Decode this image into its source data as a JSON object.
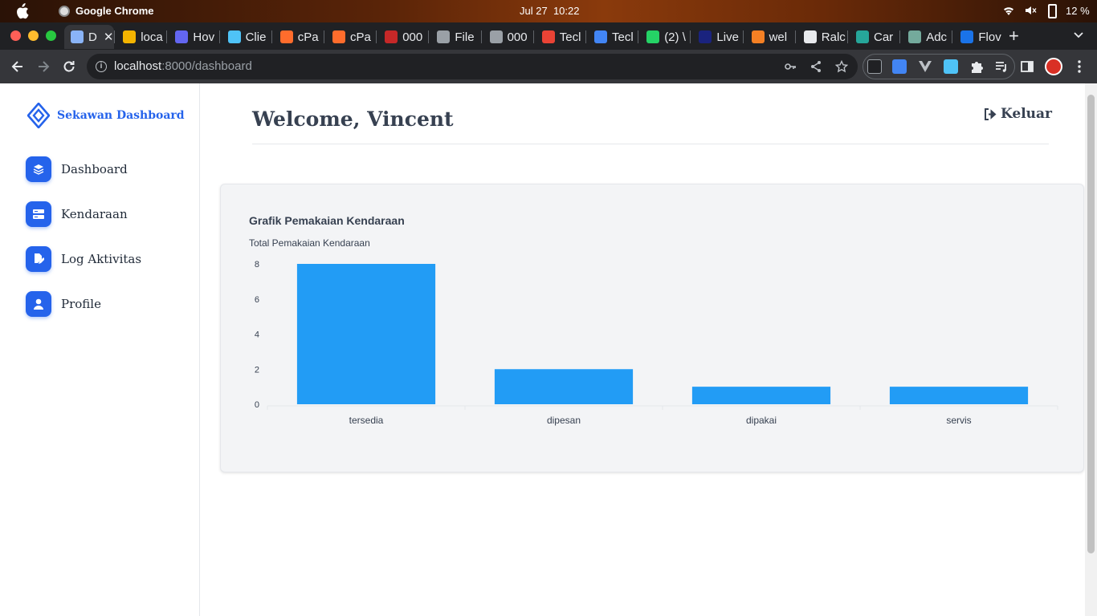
{
  "os": {
    "app_name": "Google Chrome",
    "date": "Jul 27",
    "time": "10:22",
    "battery": "12 %"
  },
  "browser": {
    "tabs": [
      {
        "label": "D",
        "favicon": "sekawan-diamond-icon",
        "color": "#8ab4f8",
        "active": true
      },
      {
        "label": "loca",
        "favicon": "laravel-icon",
        "color": "#f4b400"
      },
      {
        "label": "Hov",
        "favicon": "terminal-icon",
        "color": "#6366f1"
      },
      {
        "label": "Clie",
        "favicon": "home-icon",
        "color": "#4fc3f7"
      },
      {
        "label": "cPa",
        "favicon": "cpanel-icon",
        "color": "#ff6c2c"
      },
      {
        "label": "cPa",
        "favicon": "cpanel-icon",
        "color": "#ff6c2c"
      },
      {
        "label": "000",
        "favicon": "webhost-icon",
        "color": "#c62828"
      },
      {
        "label": "File",
        "favicon": "globe-icon",
        "color": "#9aa0a6"
      },
      {
        "label": "000",
        "favicon": "globe-icon",
        "color": "#9aa0a6"
      },
      {
        "label": "Tecl",
        "favicon": "gmail-icon",
        "color": "#ea4335"
      },
      {
        "label": "Tecl",
        "favicon": "docs-icon",
        "color": "#4285f4"
      },
      {
        "label": "(2) \\",
        "favicon": "whatsapp-icon",
        "color": "#25d366"
      },
      {
        "label": "Live",
        "favicon": "live-icon",
        "color": "#1a237e"
      },
      {
        "label": "wel",
        "favicon": "stackoverflow-icon",
        "color": "#f48024"
      },
      {
        "label": "Ralc",
        "favicon": "github-icon",
        "color": "#e8eaed"
      },
      {
        "label": "Car",
        "favicon": "car-icon",
        "color": "#26a69a"
      },
      {
        "label": "Adc",
        "favicon": "openai-icon",
        "color": "#74aa9c"
      },
      {
        "label": "Flov",
        "favicon": "flow-icon",
        "color": "#1a73e8"
      }
    ],
    "url_host": "localhost",
    "url_rest": ":8000/dashboard"
  },
  "sidebar": {
    "brand": "Sekawan Dashboard",
    "items": [
      {
        "label": "Dashboard",
        "icon": "layers-icon"
      },
      {
        "label": "Kendaraan",
        "icon": "server-icon"
      },
      {
        "label": "Log Aktivitas",
        "icon": "file-edit-icon"
      },
      {
        "label": "Profile",
        "icon": "user-icon"
      }
    ]
  },
  "header": {
    "welcome": "Welcome, Vincent",
    "logout_label": "Keluar"
  },
  "colors": {
    "primary": "#2563eb",
    "bar": "#229cf5"
  },
  "chart_data": {
    "type": "bar",
    "title": "Grafik Pemakaian Kendaraan",
    "series": [
      {
        "name": "Total Pemakaian Kendaraan",
        "values": [
          8,
          2,
          1,
          1
        ]
      }
    ],
    "categories": [
      "tersedia",
      "dipesan",
      "dipakai",
      "servis"
    ],
    "y_ticks": [
      0,
      2,
      4,
      6,
      8
    ],
    "ylim": [
      0,
      8
    ],
    "legend": "top-left"
  }
}
